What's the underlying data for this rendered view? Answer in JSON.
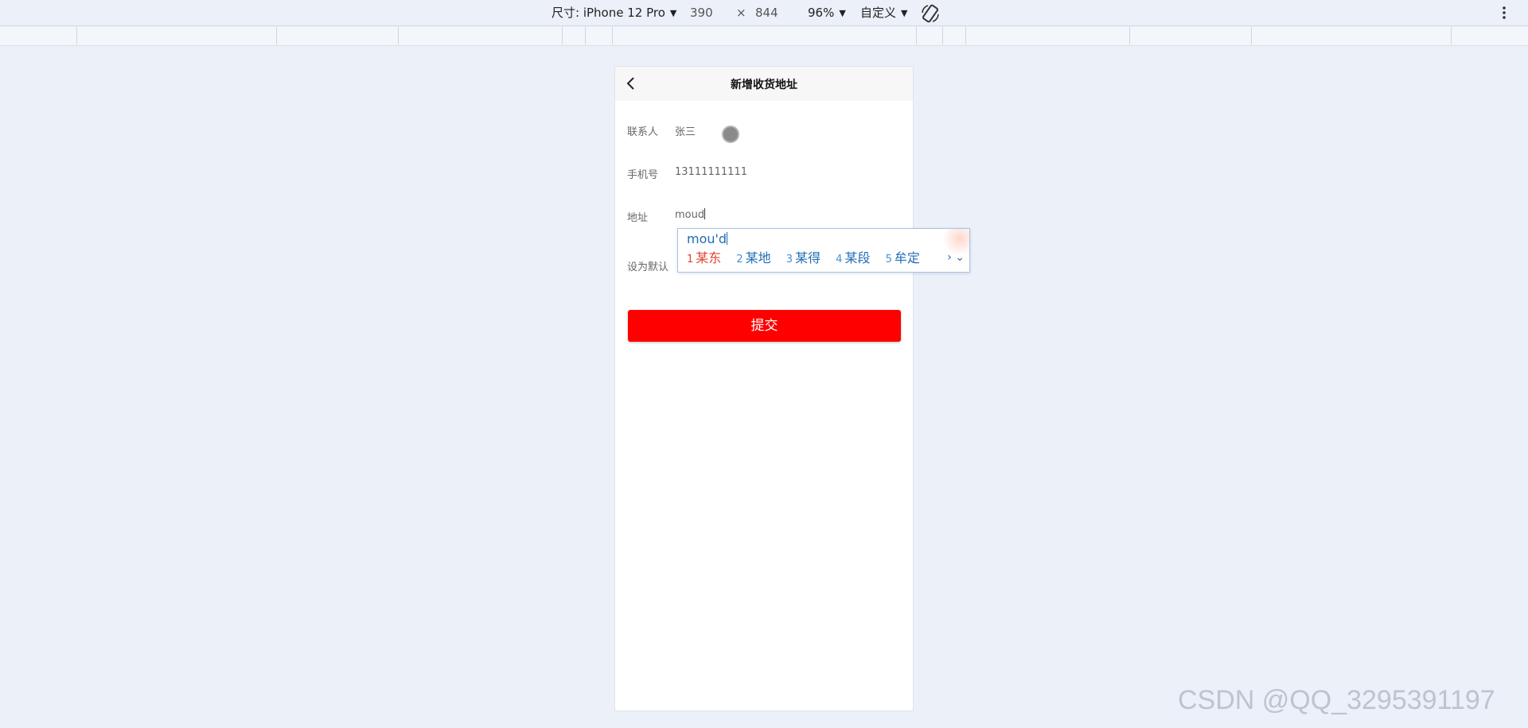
{
  "toolbar": {
    "size_label": "尺寸: iPhone 12 Pro",
    "width": "390",
    "times": "×",
    "height": "844",
    "zoom": "96%",
    "custom": "自定义"
  },
  "page": {
    "title": "新增收货地址",
    "contact_label": "联系人",
    "contact_value": "张三",
    "phone_label": "手机号",
    "phone_value": "13111111111",
    "address_label": "地址",
    "address_value": "moud",
    "default_label": "设为默认",
    "submit_label": "提交"
  },
  "ime": {
    "composition": "mou'd",
    "candidates": [
      {
        "num": "1",
        "text": "某东"
      },
      {
        "num": "2",
        "text": "某地"
      },
      {
        "num": "3",
        "text": "某得"
      },
      {
        "num": "4",
        "text": "某段"
      },
      {
        "num": "5",
        "text": "牟定"
      }
    ],
    "nav": "› ⌄"
  },
  "watermark": "CSDN @QQ_3295391197",
  "colors": {
    "background": "#ebf0f9",
    "submit_button": "#ff0000",
    "ime_text": "#1f6db5",
    "ime_selected": "#e0432e"
  }
}
